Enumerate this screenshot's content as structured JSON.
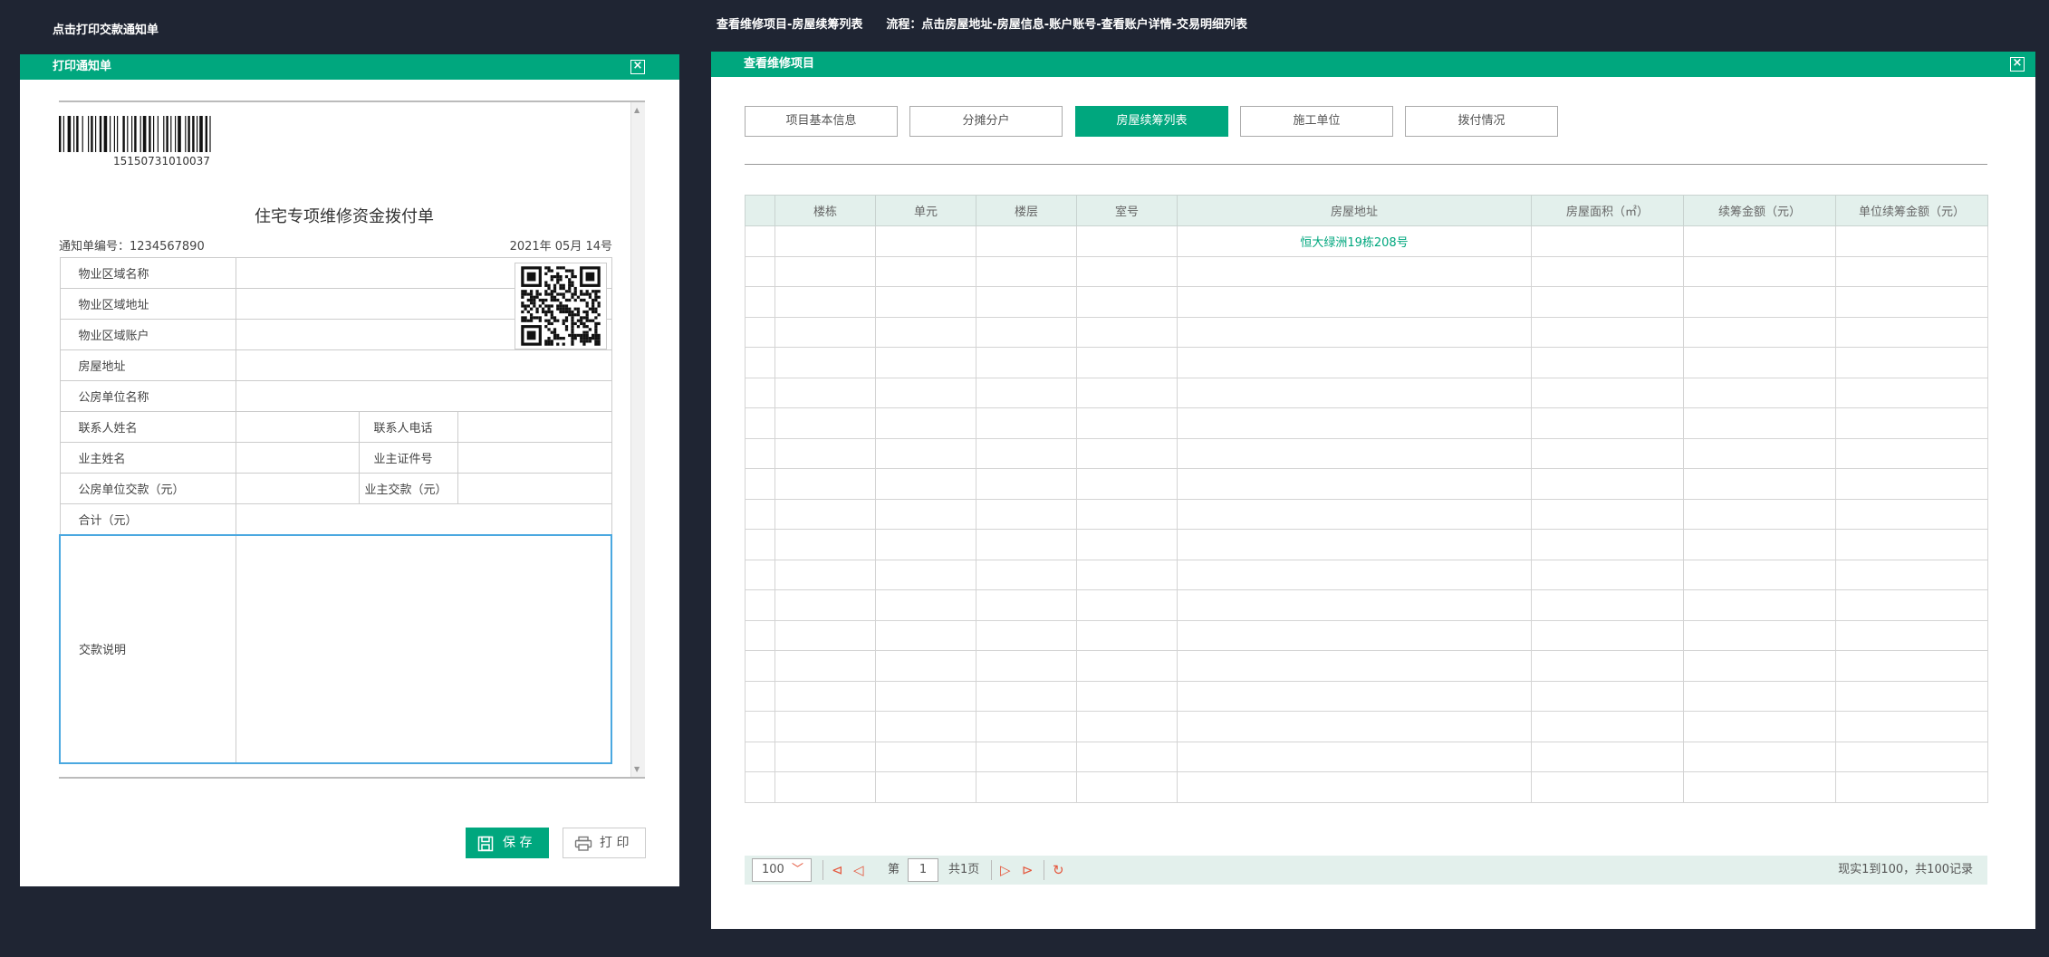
{
  "captions": {
    "left": "点击打印交款通知单",
    "right_a": "查看维修项目-房屋续筹列表",
    "right_b": "流程：点击房屋地址-房屋信息-账户账号-查看账户详情-交易明细列表"
  },
  "print_dialog": {
    "title": "打印通知单",
    "barcode_number": "15150731010037",
    "doc_title": "住宅专项维修资金拨付单",
    "notice_no": "通知单编号：1234567890",
    "date": "2021年 05月 14号",
    "rows": {
      "property_area_name": "物业区域名称",
      "property_area_address": "物业区域地址",
      "property_area_account": "物业区域账户",
      "house_address": "房屋地址",
      "public_unit_name": "公房单位名称",
      "contact_name": "联系人姓名",
      "contact_phone": "联系人电话",
      "owner_name": "业主姓名",
      "owner_id": "业主证件号",
      "public_unit_payment": "公房单位交款（元）",
      "owner_payment": "业主交款（元）",
      "total": "合计（元）",
      "payment_note": "交款说明"
    },
    "save_label": "保 存",
    "print_label": "打 印"
  },
  "repair_dialog": {
    "title": "查看维修项目",
    "tabs": [
      "项目基本信息",
      "分摊分户",
      "房屋续筹列表",
      "施工单位",
      "拨付情况"
    ],
    "active_tab": 2,
    "columns": [
      "",
      "楼栋",
      "单元",
      "楼层",
      "室号",
      "房屋地址",
      "房屋面积（㎡）",
      "续筹金额（元）",
      "单位续筹金额（元）"
    ],
    "rows": [
      [
        "",
        "",
        "",
        "",
        "",
        "恒大绿洲19栋208号",
        "",
        "",
        ""
      ]
    ],
    "empty_rows": 18,
    "pager": {
      "page_size": "100",
      "page_label": "第",
      "page": "1",
      "total_pages": "共1页",
      "info": "现实1到100，共100记录"
    }
  },
  "colors": {
    "accent": "#00a77e",
    "background": "#1f2533",
    "pager_icon": "#e4573d"
  }
}
